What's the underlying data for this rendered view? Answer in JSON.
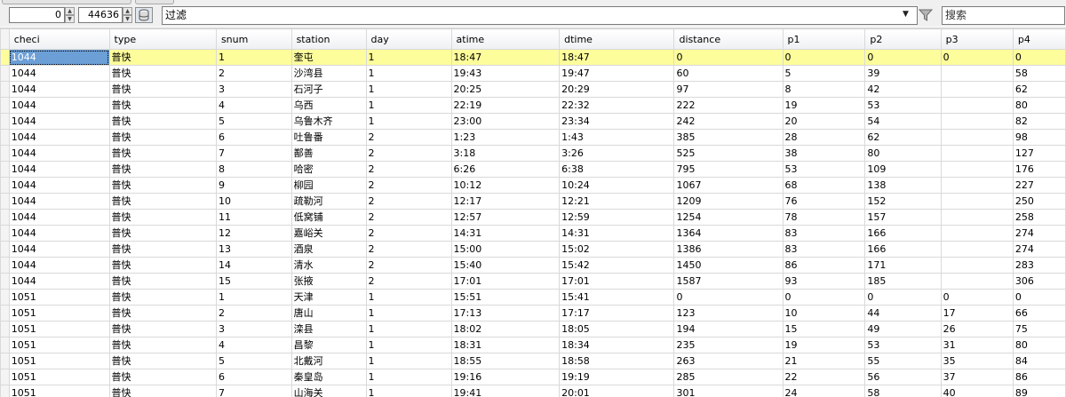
{
  "toolbar": {
    "offset_value": "0",
    "limit_value": "44636",
    "filter_placeholder": "过滤",
    "search_placeholder": "搜索"
  },
  "columns": [
    "checi",
    "type",
    "snum",
    "station",
    "day",
    "atime",
    "dtime",
    "distance",
    "p1",
    "p2",
    "p3",
    "p4"
  ],
  "rows": [
    [
      "1044",
      "普快",
      "1",
      "奎屯",
      "1",
      "18:47",
      "18:47",
      "0",
      "0",
      "0",
      "0",
      "0"
    ],
    [
      "1044",
      "普快",
      "2",
      "沙湾县",
      "1",
      "19:43",
      "19:47",
      "60",
      "5",
      "39",
      "",
      "58"
    ],
    [
      "1044",
      "普快",
      "3",
      "石河子",
      "1",
      "20:25",
      "20:29",
      "97",
      "8",
      "42",
      "",
      "62"
    ],
    [
      "1044",
      "普快",
      "4",
      "乌西",
      "1",
      "22:19",
      "22:32",
      "222",
      "19",
      "53",
      "",
      "80"
    ],
    [
      "1044",
      "普快",
      "5",
      "乌鲁木齐",
      "1",
      "23:00",
      "23:34",
      "242",
      "20",
      "54",
      "",
      "82"
    ],
    [
      "1044",
      "普快",
      "6",
      "吐鲁番",
      "2",
      "1:23",
      "1:43",
      "385",
      "28",
      "62",
      "",
      "98"
    ],
    [
      "1044",
      "普快",
      "7",
      "鄯善",
      "2",
      "3:18",
      "3:26",
      "525",
      "38",
      "80",
      "",
      "127"
    ],
    [
      "1044",
      "普快",
      "8",
      "哈密",
      "2",
      "6:26",
      "6:38",
      "795",
      "53",
      "109",
      "",
      "176"
    ],
    [
      "1044",
      "普快",
      "9",
      "柳园",
      "2",
      "10:12",
      "10:24",
      "1067",
      "68",
      "138",
      "",
      "227"
    ],
    [
      "1044",
      "普快",
      "10",
      "疏勒河",
      "2",
      "12:17",
      "12:21",
      "1209",
      "76",
      "152",
      "",
      "250"
    ],
    [
      "1044",
      "普快",
      "11",
      "低窝铺",
      "2",
      "12:57",
      "12:59",
      "1254",
      "78",
      "157",
      "",
      "258"
    ],
    [
      "1044",
      "普快",
      "12",
      "嘉峪关",
      "2",
      "14:31",
      "14:31",
      "1364",
      "83",
      "166",
      "",
      "274"
    ],
    [
      "1044",
      "普快",
      "13",
      "酒泉",
      "2",
      "15:00",
      "15:02",
      "1386",
      "83",
      "166",
      "",
      "274"
    ],
    [
      "1044",
      "普快",
      "14",
      "清水",
      "2",
      "15:40",
      "15:42",
      "1450",
      "86",
      "171",
      "",
      "283"
    ],
    [
      "1044",
      "普快",
      "15",
      "张掖",
      "2",
      "17:01",
      "17:01",
      "1587",
      "93",
      "185",
      "",
      "306"
    ],
    [
      "1051",
      "普快",
      "1",
      "天津",
      "1",
      "15:51",
      "15:41",
      "0",
      "0",
      "0",
      "0",
      "0"
    ],
    [
      "1051",
      "普快",
      "2",
      "唐山",
      "1",
      "17:13",
      "17:17",
      "123",
      "10",
      "44",
      "17",
      "66"
    ],
    [
      "1051",
      "普快",
      "3",
      "滦县",
      "1",
      "18:02",
      "18:05",
      "194",
      "15",
      "49",
      "26",
      "75"
    ],
    [
      "1051",
      "普快",
      "4",
      "昌黎",
      "1",
      "18:31",
      "18:34",
      "235",
      "19",
      "53",
      "31",
      "80"
    ],
    [
      "1051",
      "普快",
      "5",
      "北戴河",
      "1",
      "18:55",
      "18:58",
      "263",
      "21",
      "55",
      "35",
      "84"
    ],
    [
      "1051",
      "普快",
      "6",
      "秦皇岛",
      "1",
      "19:16",
      "19:19",
      "285",
      "22",
      "56",
      "37",
      "86"
    ],
    [
      "1051",
      "普快",
      "7",
      "山海关",
      "1",
      "19:41",
      "20:01",
      "301",
      "24",
      "58",
      "40",
      "89"
    ]
  ],
  "selected_row": 0,
  "colors": {
    "selected_row_bg": "#fdfd9b",
    "focus_cell_bg": "#6c9fd6"
  },
  "icons": {
    "db": "database-icon",
    "filter": "funnel-icon"
  }
}
